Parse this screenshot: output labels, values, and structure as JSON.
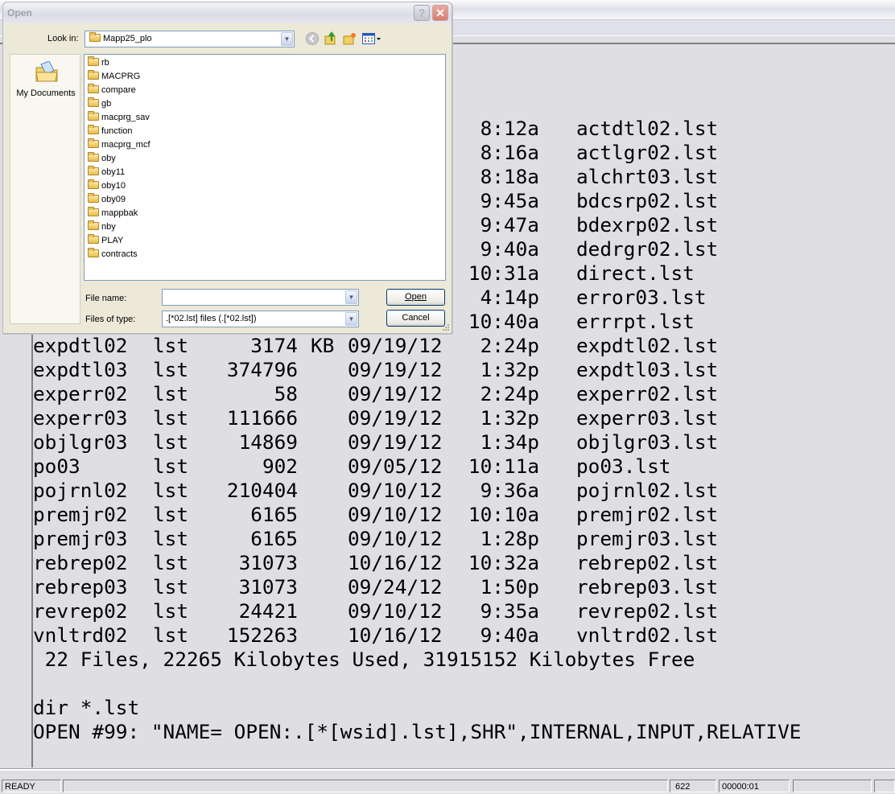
{
  "dialog": {
    "title": "Open",
    "help_label": "?",
    "close_label": "✕",
    "look_in_label": "Look in:",
    "look_in_value": "Mapp25_plo",
    "places": [
      {
        "label": "My Documents",
        "icon": "my-documents-icon"
      }
    ],
    "folders": [
      "rb",
      "MACPRG",
      "compare",
      "gb",
      "macprg_sav",
      "function",
      "macprg_mcf",
      "oby",
      "oby11",
      "oby10",
      "oby09",
      "mappbak",
      "nby",
      "PLAY",
      "contracts"
    ],
    "file_name_label": "File name:",
    "file_name_value": "",
    "files_of_type_label": "Files of type:",
    "files_of_type_value": ".[*02.lst] files (.[*02.lst])",
    "open_label": "Open",
    "cancel_label": "Cancel",
    "toolbar_icons": [
      "back-icon",
      "up-folder-icon",
      "new-folder-icon",
      "view-menu-icon"
    ]
  },
  "console": {
    "partial_rows": [
      {
        "time": "8:12a",
        "file": "actdtl02.lst"
      },
      {
        "time": "8:16a",
        "file": "actlgr02.lst"
      },
      {
        "time": "8:18a",
        "file": "alchrt03.lst"
      },
      {
        "time": "9:45a",
        "file": "bdcsrp02.lst"
      },
      {
        "time": "9:47a",
        "file": "bdexrp02.lst"
      },
      {
        "time": "9:40a",
        "file": "dedrgr02.lst"
      },
      {
        "time": "10:31a",
        "file": "direct.lst"
      },
      {
        "time": "4:14p",
        "file": "error03.lst"
      },
      {
        "time": "10:40a",
        "file": "errrpt.lst"
      }
    ],
    "rows": [
      {
        "name": "expdtl02",
        "ext": "lst",
        "size": "3174",
        "unit": "KB",
        "date": "09/19/12",
        "time": "2:24p",
        "file": "expdtl02.lst"
      },
      {
        "name": "expdtl03",
        "ext": "lst",
        "size": "374796",
        "unit": "",
        "date": "09/19/12",
        "time": "1:32p",
        "file": "expdtl03.lst"
      },
      {
        "name": "experr02",
        "ext": "lst",
        "size": "58",
        "unit": "",
        "date": "09/19/12",
        "time": "2:24p",
        "file": "experr02.lst"
      },
      {
        "name": "experr03",
        "ext": "lst",
        "size": "111666",
        "unit": "",
        "date": "09/19/12",
        "time": "1:32p",
        "file": "experr03.lst"
      },
      {
        "name": "objlgr03",
        "ext": "lst",
        "size": "14869",
        "unit": "",
        "date": "09/19/12",
        "time": "1:34p",
        "file": "objlgr03.lst"
      },
      {
        "name": "po03",
        "ext": "lst",
        "size": "902",
        "unit": "",
        "date": "09/05/12",
        "time": "10:11a",
        "file": "po03.lst"
      },
      {
        "name": "pojrnl02",
        "ext": "lst",
        "size": "210404",
        "unit": "",
        "date": "09/10/12",
        "time": "9:36a",
        "file": "pojrnl02.lst"
      },
      {
        "name": "premjr02",
        "ext": "lst",
        "size": "6165",
        "unit": "",
        "date": "09/10/12",
        "time": "10:10a",
        "file": "premjr02.lst"
      },
      {
        "name": "premjr03",
        "ext": "lst",
        "size": "6165",
        "unit": "",
        "date": "09/10/12",
        "time": "1:28p",
        "file": "premjr03.lst"
      },
      {
        "name": "rebrep02",
        "ext": "lst",
        "size": "31073",
        "unit": "",
        "date": "10/16/12",
        "time": "10:32a",
        "file": "rebrep02.lst"
      },
      {
        "name": "rebrep03",
        "ext": "lst",
        "size": "31073",
        "unit": "",
        "date": "09/24/12",
        "time": "1:50p",
        "file": "rebrep03.lst"
      },
      {
        "name": "revrep02",
        "ext": "lst",
        "size": "24421",
        "unit": "",
        "date": "09/10/12",
        "time": "9:35a",
        "file": "revrep02.lst"
      },
      {
        "name": "vnltrd02",
        "ext": "lst",
        "size": "152263",
        "unit": "",
        "date": "10/16/12",
        "time": "9:40a",
        "file": "vnltrd02.lst"
      }
    ],
    "summary": " 22 Files, 22265 Kilobytes Used, 31915152 Kilobytes Free",
    "blank": "",
    "command": "dir *.lst",
    "open_statement": "OPEN #99: \"NAME= OPEN:.[*[wsid].lst],SHR\",INTERNAL,INPUT,RELATIVE"
  },
  "statusbar": {
    "status": "READY",
    "message": "",
    "line": "622",
    "timer": "00000:01",
    "cell4": "",
    "cell5": ""
  }
}
